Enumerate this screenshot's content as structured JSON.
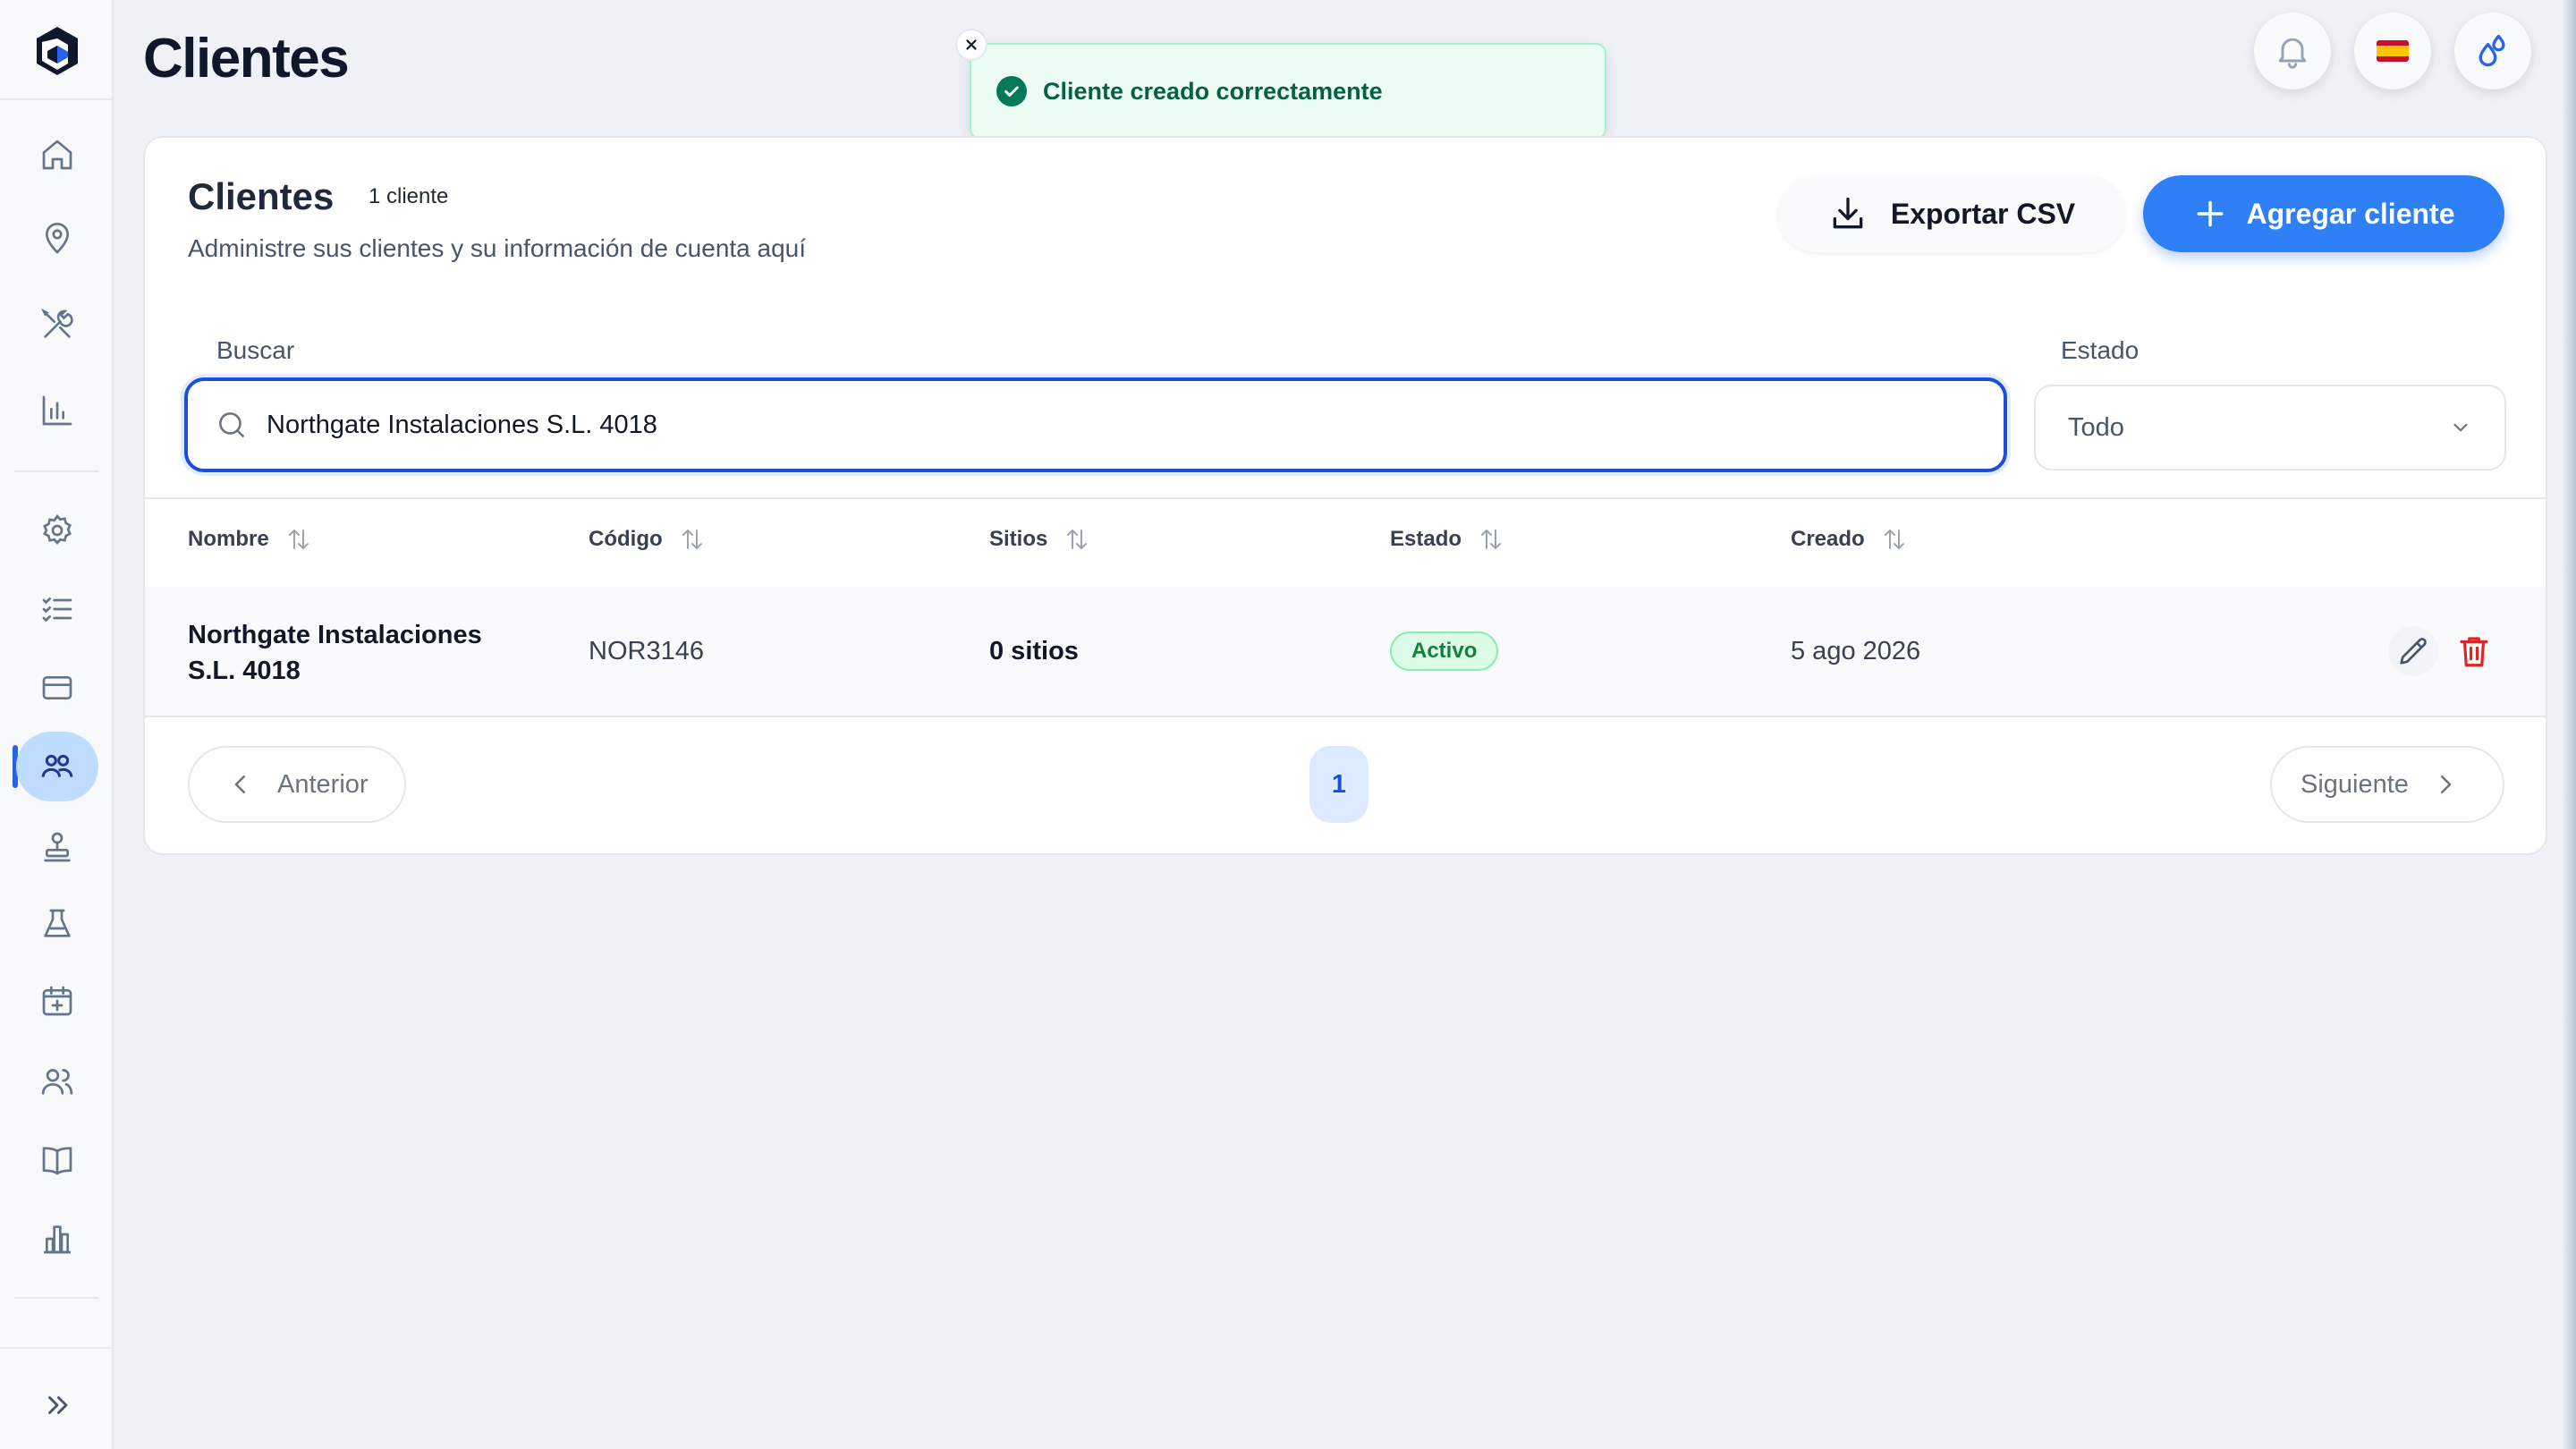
{
  "header": {
    "title": "Clientes"
  },
  "toast": {
    "message": "Cliente creado correctamente",
    "close_glyph": "×"
  },
  "card": {
    "title": "Clientes",
    "count": "1 cliente",
    "subtitle": "Administre sus clientes y su información de cuenta aquí",
    "export_label": "Exportar CSV",
    "add_label": "Agregar cliente"
  },
  "filters": {
    "search_label": "Buscar",
    "search_value": "Northgate Instalaciones S.L. 4018",
    "status_label": "Estado",
    "status_value": "Todo"
  },
  "table": {
    "columns": [
      "Nombre",
      "Código",
      "Sitios",
      "Estado",
      "Creado"
    ],
    "rows": [
      {
        "name_line1": "Northgate Instalaciones",
        "name_line2": "S.L. 4018",
        "code": "NOR3146",
        "sites": "0 sitios",
        "status": "Activo",
        "created": "5 ago 2026"
      }
    ]
  },
  "pagination": {
    "prev": "Anterior",
    "page": "1",
    "next": "Siguiente"
  },
  "colors": {
    "accent": "#2f80f7",
    "success": "#15803d",
    "danger": "#dc2626",
    "active_nav": "#bfdbfe"
  },
  "sidebar": {
    "items": [
      "home-icon",
      "map-pin-icon",
      "tools-icon",
      "bar-chart-icon",
      "settings-icon",
      "checklist-icon",
      "credit-card-icon",
      "clients-icon",
      "stamp-icon",
      "flask-icon",
      "calendar-plus-icon",
      "users-icon",
      "book-icon",
      "building-chart-icon"
    ],
    "active": "clients-icon"
  },
  "topbar": {
    "icons": [
      "bell-icon",
      "spain-flag-icon",
      "water-drops-icon"
    ]
  }
}
